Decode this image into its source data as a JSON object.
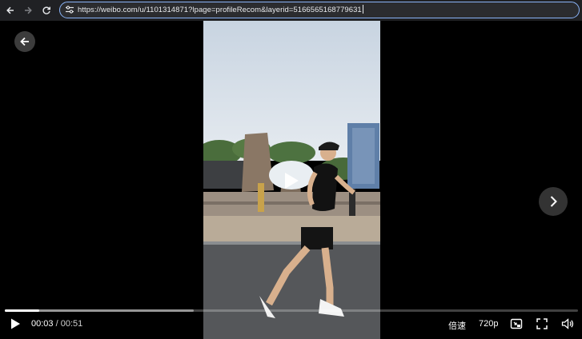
{
  "browser": {
    "url": "https://weibo.com/u/1101314871?lpage=profileRecom&layerid=5166565168779631",
    "icons": [
      "back-arrow-icon",
      "forward-arrow-icon",
      "reload-icon",
      "site-settings-icon"
    ]
  },
  "player": {
    "current_time": "00:03",
    "separator": "/",
    "duration": "00:51",
    "played_fraction": 0.06,
    "buffered_fraction": 0.33,
    "speed_label": "倍速",
    "quality_label": "720p",
    "icons": [
      "back-icon",
      "next-video-icon",
      "play-icon",
      "center-play-icon",
      "mini-window-icon",
      "fullscreen-icon",
      "volume-icon"
    ]
  },
  "colors": {
    "accent": "#8ab4f8",
    "background": "#000000",
    "controls": "#ffffff"
  }
}
